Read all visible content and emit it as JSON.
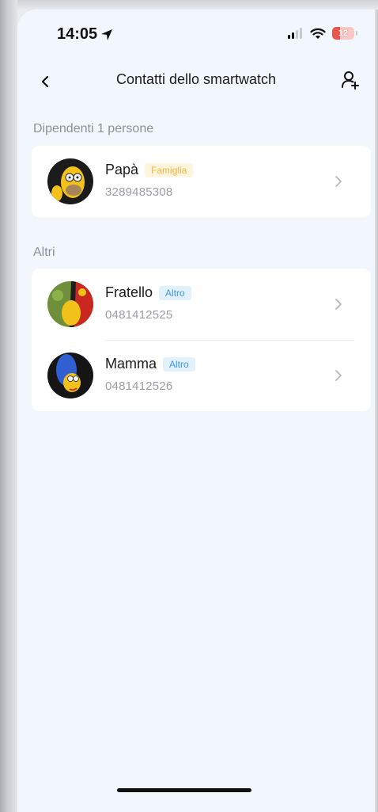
{
  "status_bar": {
    "time": "14:05",
    "battery_level": "12",
    "icons": [
      "location-arrow-icon",
      "signal-icon",
      "wifi-icon",
      "battery-icon"
    ]
  },
  "nav": {
    "title": "Contatti dello smartwatch",
    "back_icon": "chevron-left-icon",
    "add_icon": "add-person-icon"
  },
  "sections": {
    "dependents": {
      "title": "Dipendenti 1 persone",
      "contacts": [
        {
          "name": "Papà",
          "tag": "Famiglia",
          "phone": "3289485308"
        }
      ]
    },
    "others": {
      "title": "Altri",
      "contacts": [
        {
          "name": "Fratello",
          "tag": "Altro",
          "phone": "0481412525"
        },
        {
          "name": "Mamma",
          "tag": "Altro",
          "phone": "0481412526"
        }
      ]
    }
  },
  "colors": {
    "background": "#f2f6fd",
    "tag_family_bg": "#fff5df",
    "tag_family_text": "#f5b53f",
    "tag_other_bg": "#e3f1fd",
    "tag_other_text": "#3a98ec",
    "battery_low": "#e8574c"
  }
}
